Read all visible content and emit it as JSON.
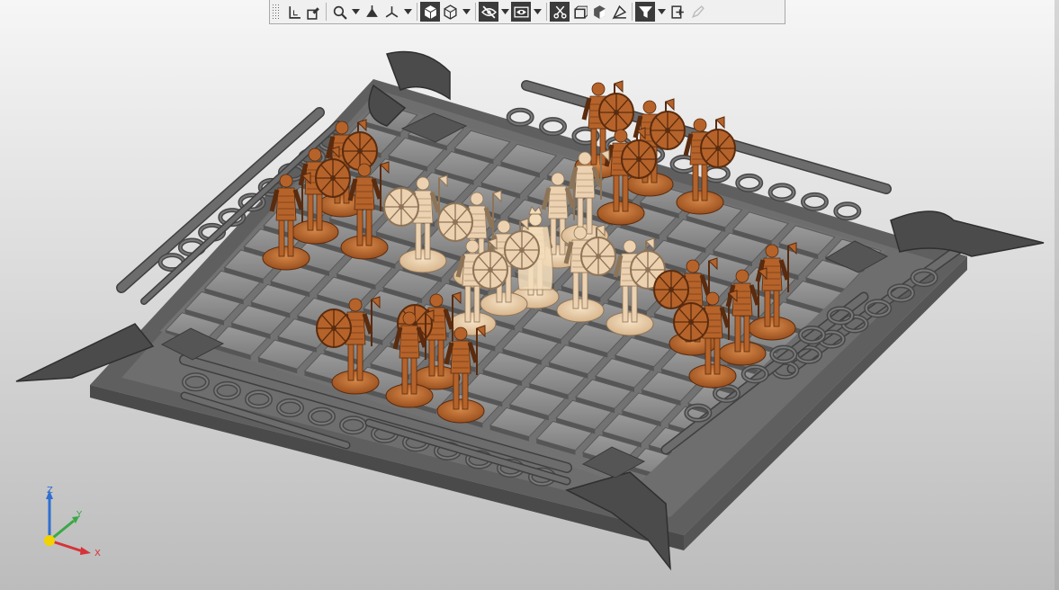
{
  "window": {
    "background_top": "#f6f6f6",
    "background_bottom": "#bcbcbc"
  },
  "toolbar": {
    "items": [
      {
        "name": "toolbar-grip",
        "icon": "grip-icon"
      },
      {
        "name": "sketch-button",
        "icon": "sketch-icon"
      },
      {
        "name": "sketch-plane-button",
        "icon": "sketch-plane-icon"
      },
      {
        "name": "zoom-button",
        "icon": "zoom-magnifier-icon",
        "dropdown": true
      },
      {
        "name": "orient-button",
        "icon": "orient-view-icon"
      },
      {
        "name": "view-orientation-button",
        "icon": "triad-view-icon",
        "dropdown": true
      },
      {
        "name": "shaded-display-button",
        "icon": "shaded-cube-icon",
        "active": true
      },
      {
        "name": "wireframe-display-button",
        "icon": "wireframe-cube-icon",
        "dropdown": true
      },
      {
        "name": "hide-show-button",
        "icon": "eye-slash-icon",
        "active": true,
        "dropdown": true
      },
      {
        "name": "visibility-button",
        "icon": "eye-frame-icon",
        "active": true,
        "dropdown": true
      },
      {
        "name": "section-view-button",
        "icon": "section-scissors-icon",
        "active": true
      },
      {
        "name": "view-cube-button",
        "icon": "box-frame-icon"
      },
      {
        "name": "appearance-button",
        "icon": "appearance-cube-icon"
      },
      {
        "name": "scene-button",
        "icon": "scene-icon"
      },
      {
        "name": "filter-button",
        "icon": "filter-funnel-icon",
        "active": true,
        "dropdown": true
      },
      {
        "name": "render-settings-button",
        "icon": "render-settings-icon"
      },
      {
        "name": "markup-button",
        "icon": "pen-icon",
        "disabled": true
      }
    ]
  },
  "triad": {
    "labels": {
      "z": "Z",
      "y": "Y",
      "x": "X"
    },
    "colors": {
      "z": "#2f6fd0",
      "y": "#39a845",
      "x": "#d6323a",
      "origin": "#f2d200"
    }
  },
  "model": {
    "board_color": "#8a8a8a",
    "attacker_color": "#b5632a",
    "defender_color": "#ecd2b0",
    "king_color": "#f3dcba"
  }
}
